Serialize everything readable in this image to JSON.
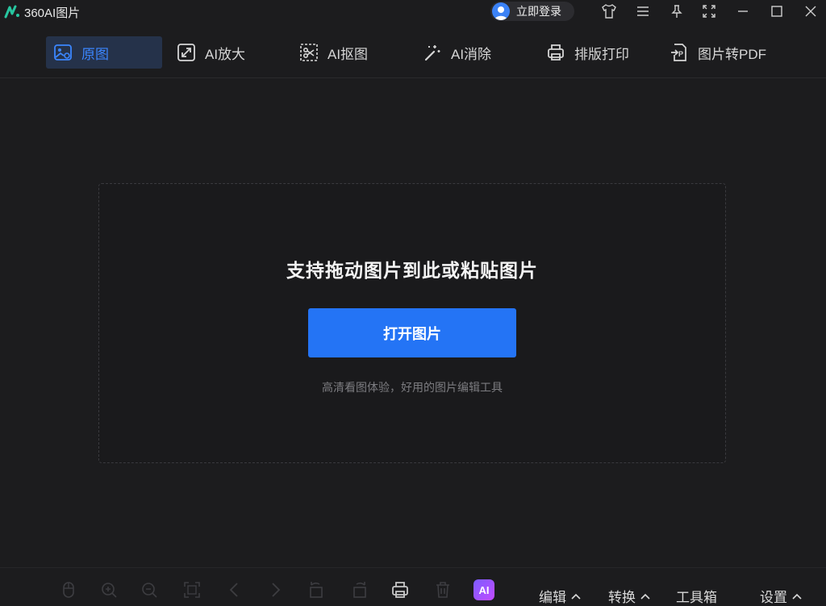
{
  "app": {
    "title": "360AI图片",
    "login_label": "立即登录"
  },
  "tabs": [
    {
      "label": "原图",
      "icon": "original-image-icon",
      "active": true
    },
    {
      "label": "AI放大",
      "icon": "enlarge-icon",
      "active": false
    },
    {
      "label": "AI抠图",
      "icon": "cutout-icon",
      "active": false
    },
    {
      "label": "AI消除",
      "icon": "magic-wand-icon",
      "active": false
    },
    {
      "label": "排版打印",
      "icon": "printer-icon",
      "active": false
    },
    {
      "label": "图片转PDF",
      "icon": "pdf-convert-icon",
      "active": false
    }
  ],
  "drop": {
    "title": "支持拖动图片到此或粘贴图片",
    "button_label": "打开图片",
    "subtitle": "高清看图体验，好用的图片编辑工具"
  },
  "bottom": {
    "ai_label": "AI",
    "menus": [
      "编辑",
      "转换",
      "工具箱",
      "设置"
    ]
  },
  "colors": {
    "accent": "#2474f5",
    "active_tab_bg": "#25324a",
    "background": "#1c1c1e"
  }
}
